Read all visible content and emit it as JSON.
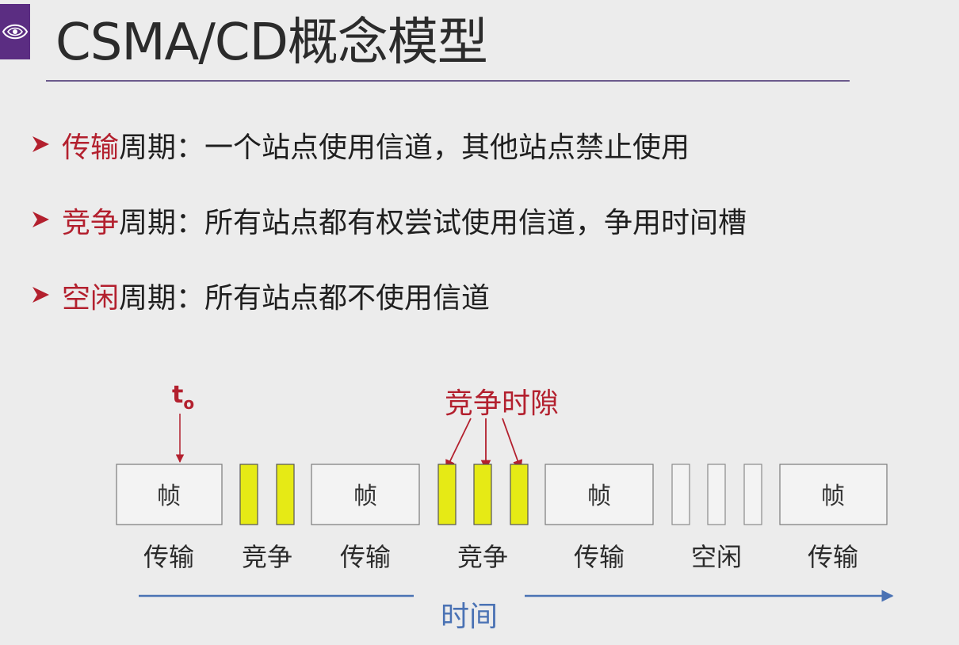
{
  "slide": {
    "title": "CSMA/CD概念模型",
    "bullets": [
      {
        "keyword": "传输",
        "rest": "周期：一个站点使用信道，其他站点禁止使用"
      },
      {
        "keyword": "竞争",
        "rest": "周期：所有站点都有权尝试使用信道，争用时间槽"
      },
      {
        "keyword": "空闲",
        "rest": "周期：所有站点都不使用信道"
      }
    ]
  },
  "diagram": {
    "t0_label": "t",
    "t0_subscript": "o",
    "contention_slot_label": "竞争时隙",
    "frame_label": "帧",
    "period_labels": [
      "传输",
      "竞争",
      "传输",
      "竞争",
      "传输",
      "空闲",
      "传输"
    ],
    "time_label": "时间",
    "colors": {
      "accent_red": "#b3202e",
      "slot_yellow": "#e6ea15",
      "time_blue": "#4a72b4",
      "logo_purple": "#5b2d82"
    }
  }
}
